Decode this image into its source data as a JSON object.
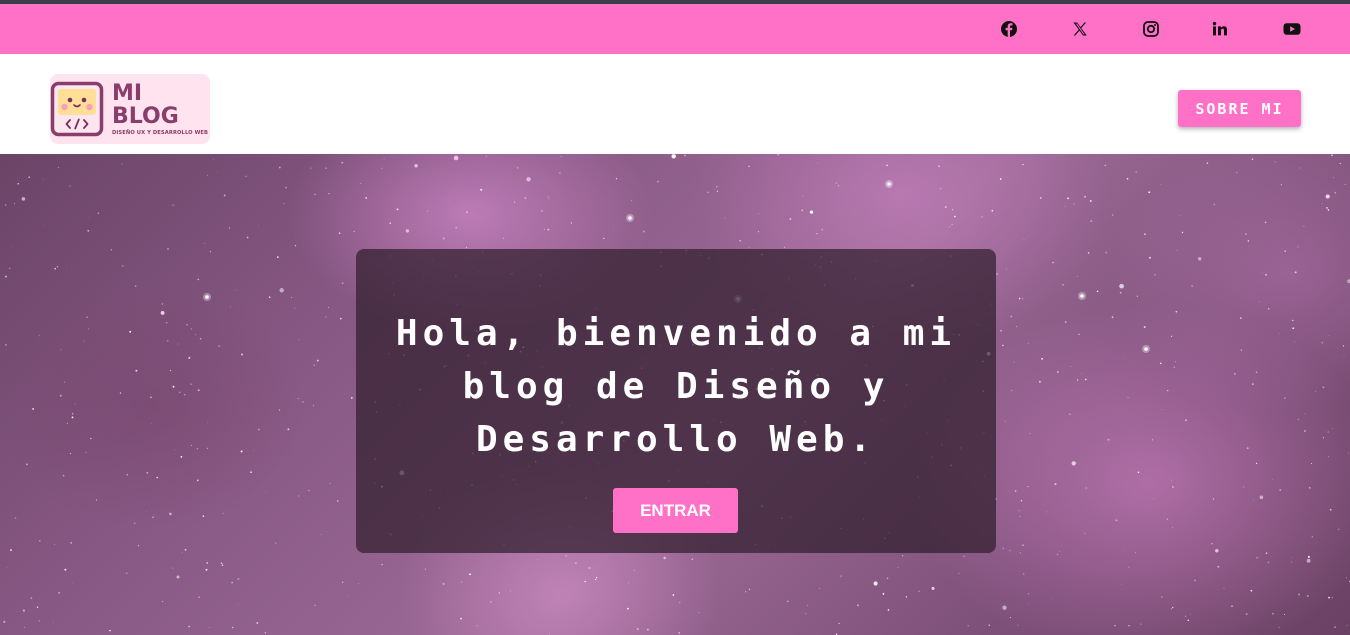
{
  "social": {
    "icons": [
      "facebook-icon",
      "x-icon",
      "instagram-icon",
      "linkedin-icon",
      "youtube-icon"
    ],
    "bar_color": "#ff71c6"
  },
  "header": {
    "logo": {
      "line1": "MI",
      "line2": "BLOG",
      "tagline": "DISEÑO UX Y DESARROLLO WEB"
    },
    "nav_button": "SOBRE MI"
  },
  "hero": {
    "title": "Hola, bienvenido a mi blog de Diseño y Desarrollo Web.",
    "button": "ENTRAR"
  },
  "colors": {
    "accent": "#ff71c6",
    "logo_background": "#ffe4ef",
    "logo_text": "#8a3c6c"
  }
}
